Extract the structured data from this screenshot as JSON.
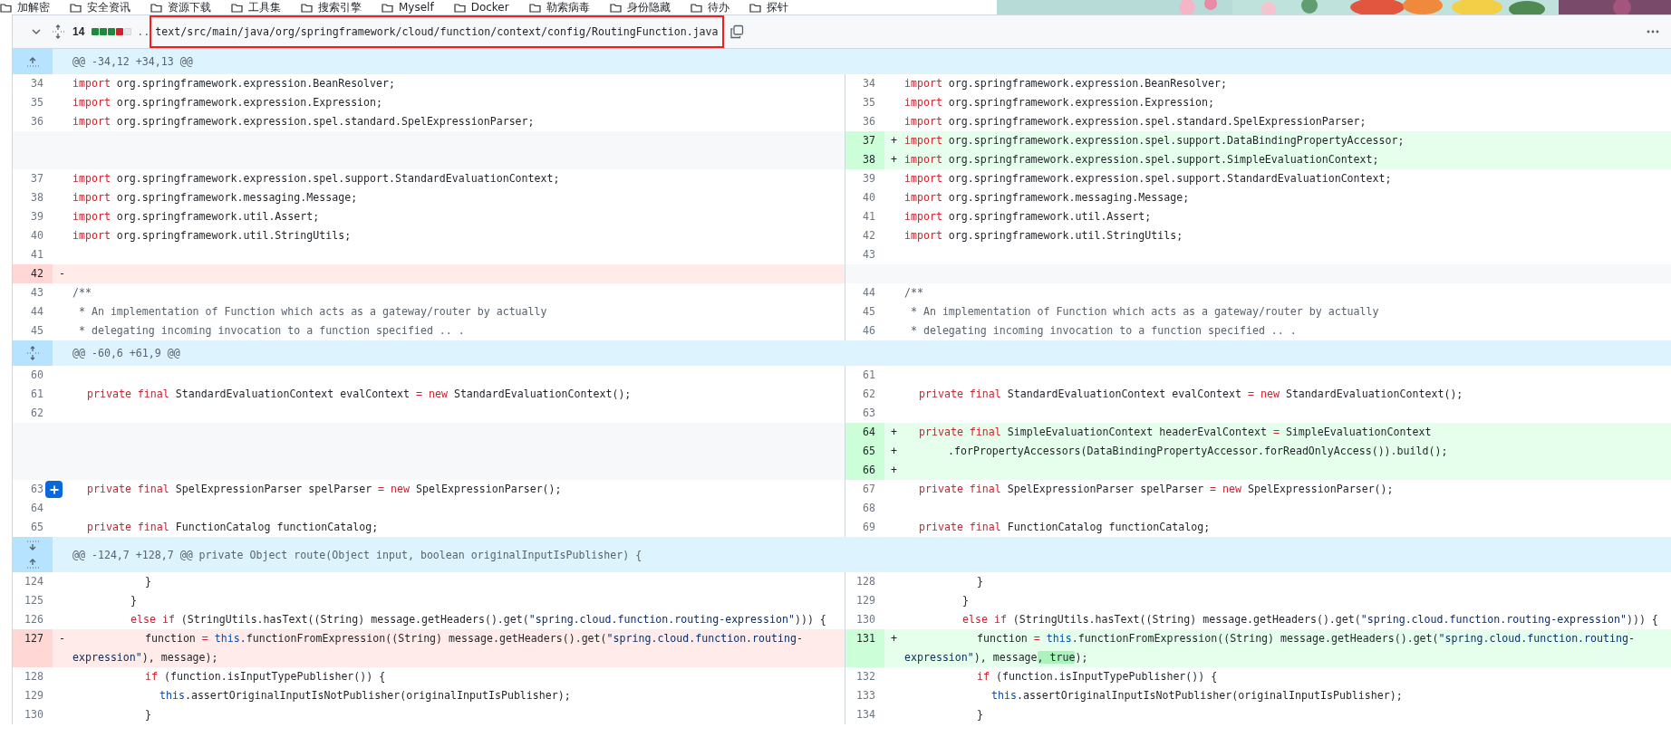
{
  "bookmarks": [
    {
      "label": "加解密"
    },
    {
      "label": "安全资讯"
    },
    {
      "label": "资源下载"
    },
    {
      "label": "工具集"
    },
    {
      "label": "搜索引擎"
    },
    {
      "label": "Myself"
    },
    {
      "label": "Docker"
    },
    {
      "label": "勒索病毒"
    },
    {
      "label": "身份隐藏"
    },
    {
      "label": "待办"
    },
    {
      "label": "探针"
    }
  ],
  "file_header": {
    "expanded": true,
    "changes": "14",
    "diffstat": [
      {
        "kind": "added"
      },
      {
        "kind": "added"
      },
      {
        "kind": "added"
      },
      {
        "kind": "deleted"
      },
      {
        "kind": "neutral"
      }
    ],
    "path_prefix": "..",
    "path": "text/src/main/java/org/springframework/cloud/function/context/config/RoutingFunction.java",
    "path_outlined": true
  },
  "diff": [
    {
      "kind": "hunk",
      "header": "@@ -34,12 +34,13 @@",
      "expand": [
        {
          "kind": "up"
        }
      ]
    },
    {
      "kind": "line",
      "left": {
        "number": "34",
        "kind": "context",
        "code": "import org.springframework.expression.BeanResolver;"
      },
      "right": {
        "number": "34",
        "kind": "context",
        "code": "import org.springframework.expression.BeanResolver;"
      }
    },
    {
      "kind": "line",
      "left": {
        "number": "35",
        "kind": "context",
        "code": "import org.springframework.expression.Expression;"
      },
      "right": {
        "number": "35",
        "kind": "context",
        "code": "import org.springframework.expression.Expression;"
      }
    },
    {
      "kind": "line",
      "left": {
        "number": "36",
        "kind": "context",
        "code": "import org.springframework.expression.spel.standard.SpelExpressionParser;"
      },
      "right": {
        "number": "36",
        "kind": "context",
        "code": "import org.springframework.expression.spel.standard.SpelExpressionParser;"
      }
    },
    {
      "kind": "line",
      "left": {
        "kind": "empty"
      },
      "right": {
        "number": "37",
        "kind": "added",
        "sign": "+",
        "code": "import org.springframework.expression.spel.support.DataBindingPropertyAccessor;"
      }
    },
    {
      "kind": "line",
      "left": {
        "kind": "empty"
      },
      "right": {
        "number": "38",
        "kind": "added",
        "sign": "+",
        "code": "import org.springframework.expression.spel.support.SimpleEvaluationContext;"
      }
    },
    {
      "kind": "line",
      "left": {
        "number": "37",
        "kind": "context",
        "code": "import org.springframework.expression.spel.support.StandardEvaluationContext;"
      },
      "right": {
        "number": "39",
        "kind": "context",
        "code": "import org.springframework.expression.spel.support.StandardEvaluationContext;"
      }
    },
    {
      "kind": "line",
      "left": {
        "number": "38",
        "kind": "context",
        "code": "import org.springframework.messaging.Message;"
      },
      "right": {
        "number": "40",
        "kind": "context",
        "code": "import org.springframework.messaging.Message;"
      }
    },
    {
      "kind": "line",
      "left": {
        "number": "39",
        "kind": "context",
        "code": "import org.springframework.util.Assert;"
      },
      "right": {
        "number": "41",
        "kind": "context",
        "code": "import org.springframework.util.Assert;"
      }
    },
    {
      "kind": "line",
      "left": {
        "number": "40",
        "kind": "context",
        "code": "import org.springframework.util.StringUtils;"
      },
      "right": {
        "number": "42",
        "kind": "context",
        "code": "import org.springframework.util.StringUtils;"
      }
    },
    {
      "kind": "line",
      "left": {
        "number": "41",
        "kind": "context"
      },
      "right": {
        "number": "43",
        "kind": "context"
      }
    },
    {
      "kind": "line",
      "left": {
        "number": "42",
        "kind": "deleted",
        "sign": "-"
      },
      "right": {
        "kind": "empty"
      }
    },
    {
      "kind": "line",
      "left": {
        "number": "43",
        "kind": "context",
        "code": "/**"
      },
      "right": {
        "number": "44",
        "kind": "context",
        "code": "/**"
      }
    },
    {
      "kind": "line",
      "left": {
        "number": "44",
        "kind": "context",
        "code": " * An implementation of Function which acts as a gateway/router by actually"
      },
      "right": {
        "number": "45",
        "kind": "context",
        "code": " * An implementation of Function which acts as a gateway/router by actually"
      }
    },
    {
      "kind": "line",
      "left": {
        "number": "45",
        "kind": "context",
        "code": " * delegating incoming invocation to a function specified .. ."
      },
      "right": {
        "number": "46",
        "kind": "context",
        "code": " * delegating incoming invocation to a function specified .. ."
      }
    },
    {
      "kind": "hunk",
      "header": "@@ -60,6 +61,9 @@",
      "expand": [
        {
          "kind": "both"
        }
      ]
    },
    {
      "kind": "line",
      "left": {
        "number": "60",
        "kind": "context"
      },
      "right": {
        "number": "61",
        "kind": "context"
      }
    },
    {
      "kind": "line",
      "left": {
        "number": "61",
        "kind": "context",
        "code": "\tprivate final StandardEvaluationContext evalContext = new StandardEvaluationContext();"
      },
      "right": {
        "number": "62",
        "kind": "context",
        "code": "\tprivate final StandardEvaluationContext evalContext = new StandardEvaluationContext();"
      }
    },
    {
      "kind": "line",
      "left": {
        "number": "62",
        "kind": "context"
      },
      "right": {
        "number": "63",
        "kind": "context"
      }
    },
    {
      "kind": "line",
      "left": {
        "kind": "empty"
      },
      "right": {
        "number": "64",
        "kind": "added",
        "sign": "+",
        "code": "\tprivate final SimpleEvaluationContext headerEvalContext = SimpleEvaluationContext"
      }
    },
    {
      "kind": "line",
      "left": {
        "kind": "empty"
      },
      "right": {
        "number": "65",
        "kind": "added",
        "sign": "+",
        "code": "\t\t\t.forPropertyAccessors(DataBindingPropertyAccessor.forReadOnlyAccess()).build();"
      }
    },
    {
      "kind": "line",
      "left": {
        "kind": "empty"
      },
      "right": {
        "number": "66",
        "kind": "added",
        "sign": "+"
      }
    },
    {
      "kind": "line",
      "left": {
        "number": "63",
        "kind": "context",
        "comment_button": true,
        "code": "\tprivate final SpelExpressionParser spelParser = new SpelExpressionParser();"
      },
      "right": {
        "number": "67",
        "kind": "context",
        "code": "\tprivate final SpelExpressionParser spelParser = new SpelExpressionParser();"
      }
    },
    {
      "kind": "line",
      "left": {
        "number": "64",
        "kind": "context"
      },
      "right": {
        "number": "68",
        "kind": "context"
      }
    },
    {
      "kind": "line",
      "left": {
        "number": "65",
        "kind": "context",
        "code": "\tprivate final FunctionCatalog functionCatalog;"
      },
      "right": {
        "number": "69",
        "kind": "context",
        "code": "\tprivate final FunctionCatalog functionCatalog;"
      }
    },
    {
      "kind": "hunk",
      "header": "@@ -124,7 +128,7 @@ private Object route(Object input, boolean originalInputIsPublisher) {",
      "expand": [
        {
          "kind": "down"
        },
        {
          "kind": "up"
        }
      ]
    },
    {
      "kind": "line",
      "left": {
        "number": "124",
        "kind": "context",
        "code": "\t\t\t\t\t}"
      },
      "right": {
        "number": "128",
        "kind": "context",
        "code": "\t\t\t\t\t}"
      }
    },
    {
      "kind": "line",
      "left": {
        "number": "125",
        "kind": "context",
        "code": "\t\t\t\t}"
      },
      "right": {
        "number": "129",
        "kind": "context",
        "code": "\t\t\t\t}"
      }
    },
    {
      "kind": "line",
      "left": {
        "number": "126",
        "kind": "context",
        "code": "\t\t\t\telse if (StringUtils.hasText((String) message.getHeaders().get(\"spring.cloud.function.routing-expression\"))) {"
      },
      "right": {
        "number": "130",
        "kind": "context",
        "code": "\t\t\t\telse if (StringUtils.hasText((String) message.getHeaders().get(\"spring.cloud.function.routing-expression\"))) {"
      }
    },
    {
      "kind": "line",
      "left": {
        "number": "127",
        "kind": "deleted",
        "sign": "-",
        "code": "\t\t\t\t\tfunction = this.functionFromExpression((String) message.getHeaders().get(\"spring.cloud.function.routing-expression\"), message);"
      },
      "right": {
        "number": "131",
        "kind": "added",
        "sign": "+",
        "segments": [
          {
            "text": "\t\t\t\t\tfunction = this.functionFromExpression((String) message.getHeaders().get(\"spring.cloud.function.routing-expression\"), message",
            "emphasized": false
          },
          {
            "text": ", true",
            "emphasized": true
          },
          {
            "text": ");",
            "emphasized": false
          }
        ]
      }
    },
    {
      "kind": "line",
      "left": {
        "number": "128",
        "kind": "context",
        "code": "\t\t\t\t\tif (function.isInputTypePublisher()) {"
      },
      "right": {
        "number": "132",
        "kind": "context",
        "code": "\t\t\t\t\tif (function.isInputTypePublisher()) {"
      }
    },
    {
      "kind": "line",
      "left": {
        "number": "129",
        "kind": "context",
        "code": "\t\t\t\t\t\tthis.assertOriginalInputIsNotPublisher(originalInputIsPublisher);"
      },
      "right": {
        "number": "133",
        "kind": "context",
        "code": "\t\t\t\t\t\tthis.assertOriginalInputIsNotPublisher(originalInputIsPublisher);"
      }
    },
    {
      "kind": "line",
      "left": {
        "number": "130",
        "kind": "context",
        "code": "\t\t\t\t\t}"
      },
      "right": {
        "number": "134",
        "kind": "context",
        "code": "\t\t\t\t\t}"
      }
    }
  ]
}
